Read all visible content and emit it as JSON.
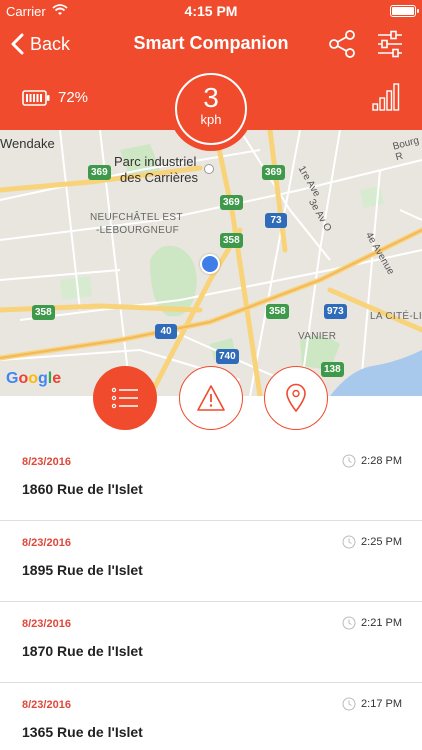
{
  "status_bar": {
    "carrier": "Carrier",
    "time": "4:15 PM"
  },
  "nav": {
    "back_label": "Back",
    "title": "Smart Companion",
    "share_icon": "share-icon",
    "filter_icon": "sliders-icon"
  },
  "info": {
    "battery_percent": "72%",
    "battery_level": 0.72,
    "speed_value": "3",
    "speed_unit": "kph",
    "signal_bars": 4
  },
  "map": {
    "labels": {
      "wendake": "Wendake",
      "parc1": "Parc industriel",
      "parc2": "des Carrières",
      "neuf1": "NEUFCHÂTEL EST",
      "neuf2": "-LEBOURGNEUF",
      "vanier": "VANIER",
      "citelim": "LA CITÉ-LIMOILOU",
      "ave1e": "1re Ave",
      "ave3e": "3e Av O",
      "ave4e": "4e Avenue",
      "bourg": "Bourg R",
      "google": "Google"
    },
    "shields": {
      "s369a": "369",
      "s369b": "369",
      "s369c": "369",
      "s358a": "358",
      "s358b": "358",
      "s358c": "358",
      "s73": "73",
      "s40": "40",
      "s740": "740",
      "s973": "973",
      "s138": "138"
    }
  },
  "actions": {
    "list_icon": "list-icon",
    "alert_icon": "warning-icon",
    "place_icon": "location-pin-icon"
  },
  "history": [
    {
      "date": "8/23/2016",
      "time": "2:28 PM",
      "address": "1860 Rue de l'Islet"
    },
    {
      "date": "8/23/2016",
      "time": "2:25 PM",
      "address": "1895 Rue de l'Islet"
    },
    {
      "date": "8/23/2016",
      "time": "2:21 PM",
      "address": "1870 Rue de l'Islet"
    },
    {
      "date": "8/23/2016",
      "time": "2:17 PM",
      "address": "1365 Rue de l'Islet"
    }
  ],
  "colors": {
    "accent": "#f04b2d",
    "date_red": "#e0483a",
    "location_blue": "#3f7ee8",
    "highway_green": "#3e9a4a"
  }
}
